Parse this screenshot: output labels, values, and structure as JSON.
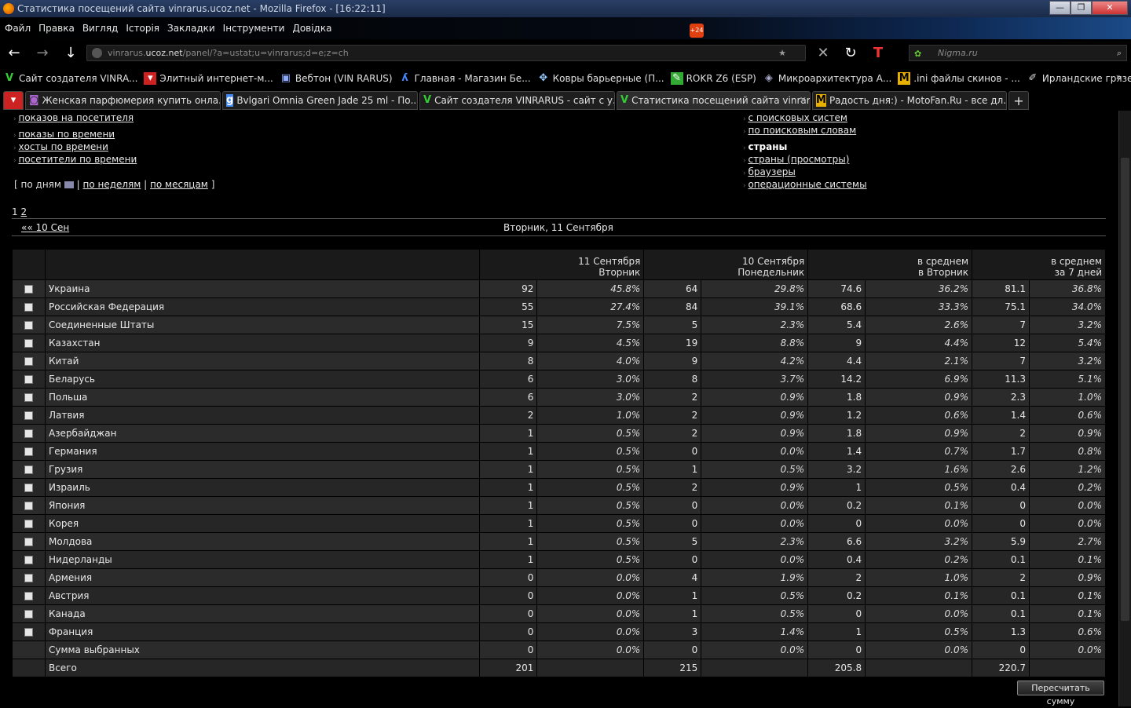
{
  "window": {
    "title": "Статистика посещений сайта vinrarus.ucoz.net - Mozilla Firefox - [16:22:11]"
  },
  "menu": {
    "items": [
      "Файл",
      "Правка",
      "Вигляд",
      "Історія",
      "Закладки",
      "Інструменти",
      "Довідка"
    ],
    "badge": "+24"
  },
  "nav": {
    "url_prefix": "vinrarus.",
    "url_host": "ucoz.net",
    "url_rest": "/panel/?a=ustat;u=vinrarus;d=e;z=ch",
    "search_placeholder": "Nigma.ru"
  },
  "bookmarks": [
    {
      "icon": "vinrarus-icon",
      "label": "Сайт создателя VINRA..."
    },
    {
      "icon": "shop-icon",
      "label": "Элитный интернет-м..."
    },
    {
      "icon": "webton-icon",
      "label": "Вебтон (VIN RARUS)"
    },
    {
      "icon": "shop-icon",
      "label": "Главная - Магазин Бе..."
    },
    {
      "icon": "carpet-icon",
      "label": "Ковры барьерные (П..."
    },
    {
      "icon": "rokr-icon",
      "label": "ROKR Z6 (ESP)"
    },
    {
      "icon": "arch-icon",
      "label": "Микроархитектура А..."
    },
    {
      "icon": "motofan-icon",
      "label": ".ini файлы скинов - ..."
    },
    {
      "icon": "pen-icon",
      "label": "Ирландские грязеза..."
    }
  ],
  "tabs": [
    {
      "icon": "perfume-icon",
      "label": "Женская парфюмерия купить онла..."
    },
    {
      "icon": "google-icon",
      "label": "Bvlgari Omnia Green Jade 25 ml - По..."
    },
    {
      "icon": "vinrarus-icon",
      "label": "Сайт создателя VINRARUS - сайт с у..."
    },
    {
      "icon": "vinrarus-icon",
      "label": "Статистика посещений сайта vinrar..."
    },
    {
      "icon": "motofan-icon",
      "label": "Радость дня:) - MotoFan.Ru - все дл..."
    }
  ],
  "links_left": [
    "показов на посетителя",
    "показы по времени",
    "хосты по времени",
    "посетители по времени"
  ],
  "links_right": {
    "item1": "с поисковых систем",
    "item2": "по поисковым словам",
    "header": "страны",
    "item3": "страны (просмотры)",
    "item4": "браузеры",
    "item5": "операционные системы"
  },
  "period": {
    "open": "[",
    "days": "по дням",
    "sep": "|",
    "weeks": "по неделям",
    "months": "по месяцам",
    "close": "]"
  },
  "pages": [
    "1",
    "2"
  ],
  "day_nav": {
    "prev": "«« 10 Сен",
    "current": "Вторник, 11 Сентября"
  },
  "columns": [
    {
      "line1": "11 Сентября",
      "line2": "Вторник"
    },
    {
      "line1": "10 Сентября",
      "line2": "Понедельник"
    },
    {
      "line1": "в среднем",
      "line2": "в Вторник"
    },
    {
      "line1": "в среднем",
      "line2": "за 7 дней"
    }
  ],
  "rows": [
    {
      "name": "Украина",
      "v": [
        "92",
        "45.8%",
        "64",
        "29.8%",
        "74.6",
        "36.2%",
        "81.1",
        "36.8%"
      ]
    },
    {
      "name": "Российская Федерация",
      "v": [
        "55",
        "27.4%",
        "84",
        "39.1%",
        "68.6",
        "33.3%",
        "75.1",
        "34.0%"
      ]
    },
    {
      "name": "Соединенные Штаты",
      "v": [
        "15",
        "7.5%",
        "5",
        "2.3%",
        "5.4",
        "2.6%",
        "7",
        "3.2%"
      ]
    },
    {
      "name": "Казахстан",
      "v": [
        "9",
        "4.5%",
        "19",
        "8.8%",
        "9",
        "4.4%",
        "12",
        "5.4%"
      ]
    },
    {
      "name": "Китай",
      "v": [
        "8",
        "4.0%",
        "9",
        "4.2%",
        "4.4",
        "2.1%",
        "7",
        "3.2%"
      ]
    },
    {
      "name": "Беларусь",
      "v": [
        "6",
        "3.0%",
        "8",
        "3.7%",
        "14.2",
        "6.9%",
        "11.3",
        "5.1%"
      ]
    },
    {
      "name": "Польша",
      "v": [
        "6",
        "3.0%",
        "2",
        "0.9%",
        "1.8",
        "0.9%",
        "2.3",
        "1.0%"
      ]
    },
    {
      "name": "Латвия",
      "v": [
        "2",
        "1.0%",
        "2",
        "0.9%",
        "1.2",
        "0.6%",
        "1.4",
        "0.6%"
      ]
    },
    {
      "name": "Азербайджан",
      "v": [
        "1",
        "0.5%",
        "2",
        "0.9%",
        "1.8",
        "0.9%",
        "2",
        "0.9%"
      ]
    },
    {
      "name": "Германия",
      "v": [
        "1",
        "0.5%",
        "0",
        "0.0%",
        "1.4",
        "0.7%",
        "1.7",
        "0.8%"
      ]
    },
    {
      "name": "Грузия",
      "v": [
        "1",
        "0.5%",
        "1",
        "0.5%",
        "3.2",
        "1.6%",
        "2.6",
        "1.2%"
      ]
    },
    {
      "name": "Израиль",
      "v": [
        "1",
        "0.5%",
        "2",
        "0.9%",
        "1",
        "0.5%",
        "0.4",
        "0.2%"
      ]
    },
    {
      "name": "Япония",
      "v": [
        "1",
        "0.5%",
        "0",
        "0.0%",
        "0.2",
        "0.1%",
        "0",
        "0.0%"
      ]
    },
    {
      "name": "Корея",
      "v": [
        "1",
        "0.5%",
        "0",
        "0.0%",
        "0",
        "0.0%",
        "0",
        "0.0%"
      ]
    },
    {
      "name": "Молдова",
      "v": [
        "1",
        "0.5%",
        "5",
        "2.3%",
        "6.6",
        "3.2%",
        "5.9",
        "2.7%"
      ]
    },
    {
      "name": "Нидерланды",
      "v": [
        "1",
        "0.5%",
        "0",
        "0.0%",
        "0.4",
        "0.2%",
        "0.1",
        "0.1%"
      ]
    },
    {
      "name": "Армения",
      "v": [
        "0",
        "0.0%",
        "4",
        "1.9%",
        "2",
        "1.0%",
        "2",
        "0.9%"
      ]
    },
    {
      "name": "Австрия",
      "v": [
        "0",
        "0.0%",
        "1",
        "0.5%",
        "0.2",
        "0.1%",
        "0.1",
        "0.1%"
      ]
    },
    {
      "name": "Канада",
      "v": [
        "0",
        "0.0%",
        "1",
        "0.5%",
        "0",
        "0.0%",
        "0.1",
        "0.1%"
      ]
    },
    {
      "name": "Франция",
      "v": [
        "0",
        "0.0%",
        "3",
        "1.4%",
        "1",
        "0.5%",
        "1.3",
        "0.6%"
      ]
    }
  ],
  "sum_row": {
    "name": "Сумма выбранных",
    "v": [
      "0",
      "0.0%",
      "0",
      "0.0%",
      "0",
      "0.0%",
      "0",
      "0.0%"
    ]
  },
  "total_row": {
    "name": "Всего",
    "v": [
      "201",
      "",
      "215",
      "",
      "205.8",
      "",
      "220.7",
      ""
    ]
  },
  "recalc_button": "Пересчитать сумму"
}
